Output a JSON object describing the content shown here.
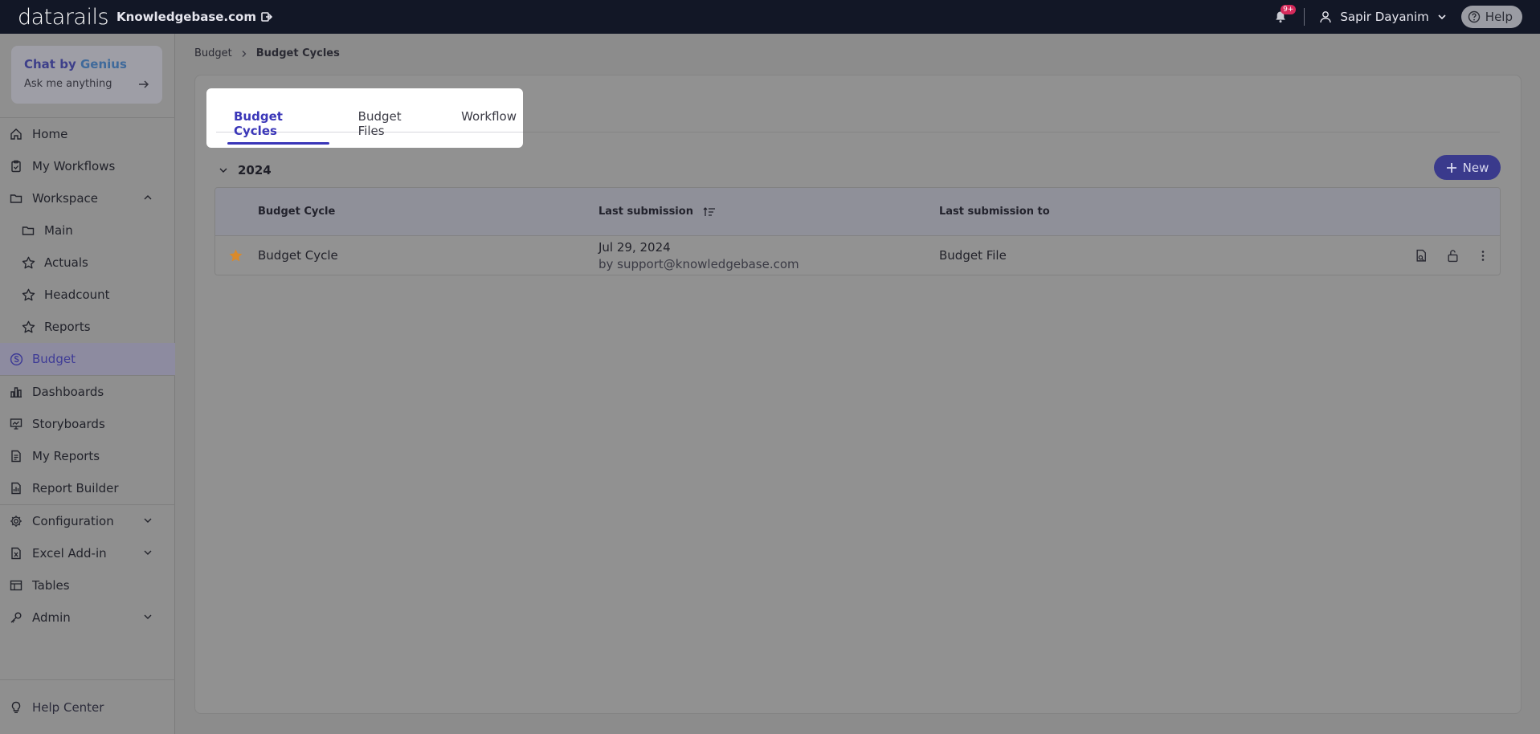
{
  "topbar": {
    "logo": "datarails",
    "domain": "Knowledgebase.com",
    "notifications_badge": "9+",
    "user_name": "Sapir Dayanim",
    "help_label": "Help"
  },
  "chat": {
    "title_prefix": "Chat by ",
    "title_brand": "Genius",
    "placeholder": "Ask me anything"
  },
  "sidebar": {
    "items": [
      {
        "label": "Home",
        "icon": "home-icon"
      },
      {
        "label": "My Workflows",
        "icon": "clipboard-icon"
      },
      {
        "label": "Workspace",
        "icon": "folder-icon"
      },
      {
        "label": "Main",
        "icon": "folder-icon"
      },
      {
        "label": "Actuals",
        "icon": "star-icon"
      },
      {
        "label": "Headcount",
        "icon": "star-icon"
      },
      {
        "label": "Reports",
        "icon": "star-icon"
      },
      {
        "label": "Budget",
        "icon": "budget-icon"
      },
      {
        "label": "Dashboards",
        "icon": "bar-chart-icon"
      },
      {
        "label": "Storyboards",
        "icon": "presentation-icon"
      },
      {
        "label": "My Reports",
        "icon": "document-icon"
      },
      {
        "label": "Report Builder",
        "icon": "report-builder-icon"
      },
      {
        "label": "Configuration",
        "icon": "gear-icon"
      },
      {
        "label": "Excel Add-in",
        "icon": "excel-icon"
      },
      {
        "label": "Tables",
        "icon": "table-icon"
      },
      {
        "label": "Admin",
        "icon": "key-icon"
      }
    ],
    "help_center": "Help Center"
  },
  "breadcrumb": {
    "parent": "Budget",
    "current": "Budget Cycles"
  },
  "tabs": [
    {
      "label": "Budget Cycles",
      "active": true
    },
    {
      "label": "Budget Files",
      "active": false
    },
    {
      "label": "Workflow",
      "active": false
    }
  ],
  "group": {
    "year": "2024",
    "new_label": "New"
  },
  "table": {
    "columns": [
      "Budget Cycle",
      "Last submission",
      "Last submission to"
    ],
    "rows": [
      {
        "name": "Budget Cycle",
        "date": "Jul 29, 2024",
        "by": "by support@knowledgebase.com",
        "to": "Budget File"
      }
    ]
  },
  "colors": {
    "accent": "#3a36b8",
    "star": "#d98a2b",
    "topbar": "#121726"
  }
}
